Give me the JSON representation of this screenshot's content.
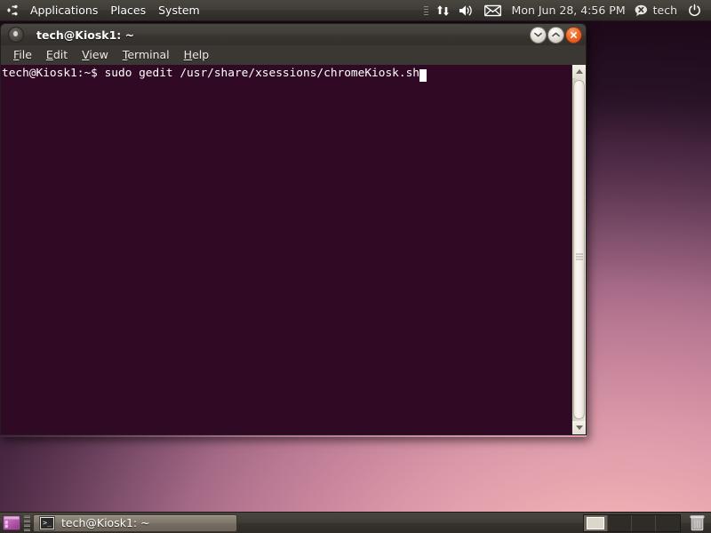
{
  "top_panel": {
    "logo_name": "ubuntu-logo",
    "menus": [
      {
        "label": "Applications"
      },
      {
        "label": "Places"
      },
      {
        "label": "System"
      }
    ],
    "indicators": {
      "grip": "panel-grip",
      "network_icon": "network-transfer-icon",
      "volume_icon": "volume-speaker-icon",
      "mail_icon": "mail-envelope-icon",
      "datetime": "Mon Jun 28,  4:56 PM",
      "user_icon": "user-status-icon",
      "user_name": "tech",
      "power_icon": "power-button-icon"
    }
  },
  "terminal": {
    "title": "tech@Kiosk1: ~",
    "window_buttons": {
      "minimize": "minimize-button",
      "maximize": "maximize-button",
      "close": "close-button"
    },
    "menubar": [
      {
        "mnemonic": "F",
        "rest": "ile"
      },
      {
        "mnemonic": "E",
        "rest": "dit"
      },
      {
        "mnemonic": "V",
        "rest": "iew"
      },
      {
        "mnemonic": "T",
        "rest": "erminal"
      },
      {
        "mnemonic": "H",
        "rest": "elp"
      }
    ],
    "prompt": "tech@Kiosk1:~$ ",
    "command": "sudo gedit /usr/share/xsessions/chromeKiosk.sh",
    "background_color": "#300a24",
    "foreground_color": "#ffffff"
  },
  "bottom_panel": {
    "show_desktop_icon": "show-desktop-icon",
    "task_button": {
      "icon": "terminal-icon",
      "icon_glyph": ">_",
      "label": "tech@Kiosk1: ~"
    },
    "workspaces": {
      "count": 4,
      "active_index": 0
    },
    "trash_icon": "trash-can-icon"
  },
  "desktop": {
    "wallpaper_name": "ubuntu-ambiance-wallpaper",
    "wallpaper_top_color": "#2b0b20",
    "wallpaper_bottom_color": "#f0b2b2"
  }
}
